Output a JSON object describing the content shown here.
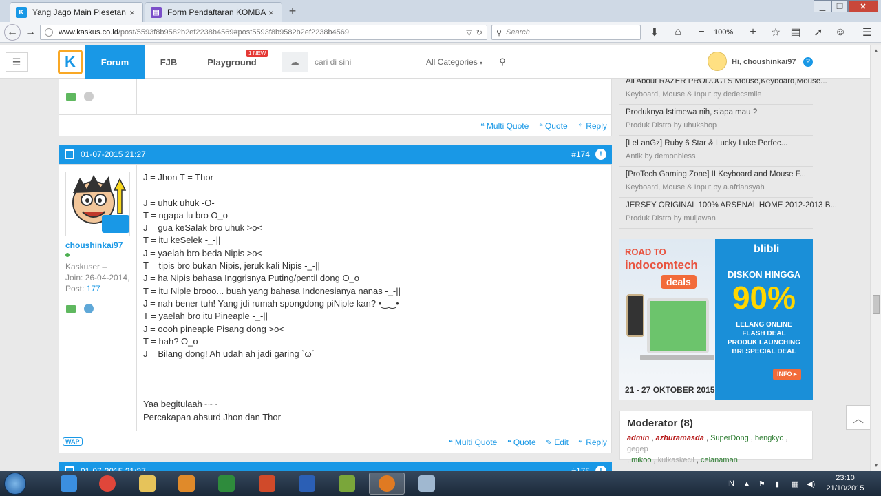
{
  "browser": {
    "tabs": [
      {
        "title": "Yang Jago Main Plesetan ...",
        "active": true
      },
      {
        "title": "Form Pendaftaran KOMBA...",
        "active": false
      }
    ],
    "url_domain": "www.kaskus.co.id",
    "url_path": "/post/5593f8b9582b2ef2238b4569#post5593f8b9582b2ef2238b4569",
    "search_placeholder": "Search",
    "zoom": "100%"
  },
  "header": {
    "nav": {
      "forum": "Forum",
      "fjb": "FJB",
      "playground": "Playground"
    },
    "new_badge": "1 NEW",
    "search_placeholder": "cari di sini",
    "category": "All Categories",
    "greeting": "Hi, choushinkai97",
    "help": "?"
  },
  "posts": {
    "prev_actions": {
      "multi_quote": "Multi Quote",
      "quote": "Quote",
      "reply": "Reply"
    },
    "post174": {
      "date": "01-07-2015 21:27",
      "number": "#174",
      "username": "choushinkai97",
      "rank": "Kaskuser –",
      "join": "Join: 26-04-2014,",
      "post_label": "Post: ",
      "post_count": "177",
      "body": [
        "J = Jhon T = Thor",
        "",
        "J = uhuk uhuk -O-",
        "T = ngapa lu bro O_o",
        "J = gua keSalak bro uhuk >o<",
        "T = itu keSelek -_-||",
        "J = yaelah bro beda Nipis >o<",
        "T = tipis bro bukan Nipis, jeruk kali Nipis -_-||",
        "J = ha Nipis bahasa Inggrisnya Puting/pentil dong O_o",
        "T = itu Niple brooo... buah yang bahasa Indonesianya nanas -_-||",
        "J = nah bener tuh! Yang jdi rumah spongdong piNiple kan? •‿‿•",
        "T = yaelah bro itu Pineaple -_-||",
        "J = oooh pineaple Pisang dong >o<",
        "T = hah? O_o",
        "J = Bilang dong! Ah udah ah jadi garing `ω´",
        "",
        "",
        "",
        "Yaa begitulaah~~~",
        "Percakapan absurd Jhon dan Thor"
      ],
      "wap": "WAP",
      "actions": {
        "multi_quote": "Multi Quote",
        "quote": "Quote",
        "edit": "Edit",
        "reply": "Reply"
      }
    },
    "next_date": "01-07-2015 21:27",
    "next_number": "#175"
  },
  "sidebar": {
    "threads": [
      {
        "title": "All About RAZER PRODUCTS Mouse,Keyboard,Mouse...",
        "sub": "Keyboard, Mouse & Input by dedecsmile"
      },
      {
        "title": "Produknya Istimewa nih, siapa mau ?",
        "sub": "Produk Distro by uhukshop"
      },
      {
        "title": "[LeLanGz] Ruby 6 Star & Lucky Luke Perfec...",
        "sub": "Antik by demonbless"
      },
      {
        "title": "[ProTech Gaming Zone] II Keyboard and Mouse F...",
        "sub": "Keyboard, Mouse & Input by a.afriansyah"
      },
      {
        "title": "JERSEY ORIGINAL 100% ARSENAL HOME 2012-2013 B...",
        "sub": "Produk Distro by muljawan"
      }
    ],
    "banner": {
      "road_to": "ROAD TO",
      "indocomtech": "indocomtech",
      "deals": "deals",
      "dates": "21 - 27 OKTOBER 2015",
      "blibli": "blibli",
      "diskon": "DISKON HINGGA",
      "percent": "90%",
      "lines": [
        "LELANG ONLINE",
        "FLASH DEAL",
        "PRODUK LAUNCHING",
        "BRI SPECIAL DEAL"
      ],
      "info": "INFO ▸"
    },
    "moderator": {
      "title": "Moderator (8)",
      "names": {
        "admin": "admin",
        "azhuramasda": "azhuramasda",
        "superdong": "SuperDong",
        "bengkyo": "bengkyo",
        "gegep": "gegep",
        "mikoo": "mikoo",
        "kulkaskecil": "kulkaskecil",
        "celanaman": "celanaman"
      }
    }
  },
  "taskbar": {
    "lang": "IN",
    "time": "23:10",
    "date": "21/10/2015"
  }
}
